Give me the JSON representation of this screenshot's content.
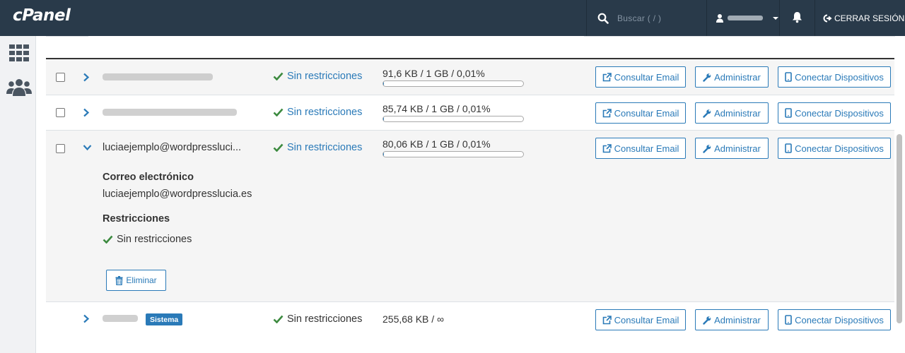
{
  "header": {
    "logo": "cPanel",
    "search_placeholder": "Buscar ( / )",
    "logout_label": "CERRAR SESIÓN"
  },
  "accounts": [
    {
      "account": "",
      "restrictions": "Sin restricciones",
      "usage": "91,6 KB / 1 GB / 0,01%",
      "usage_fraction": 0.0001,
      "buttons": {
        "email": "Consultar Email",
        "admin": "Administrar",
        "devices": "Conectar Dispositivos"
      }
    },
    {
      "account": "",
      "restrictions": "Sin restricciones",
      "usage": "85,74 KB / 1 GB / 0,01%",
      "usage_fraction": 0.0001,
      "buttons": {
        "email": "Consultar Email",
        "admin": "Administrar",
        "devices": "Conectar Dispositivos"
      }
    },
    {
      "account": "luciaejemplo@wordpressluci...",
      "restrictions": "Sin restricciones",
      "usage": "80,06 KB / 1 GB / 0,01%",
      "usage_fraction": 0.0001,
      "buttons": {
        "email": "Consultar Email",
        "admin": "Administrar",
        "devices": "Conectar Dispositivos"
      },
      "details": {
        "email_label": "Correo electrónico",
        "email_value": "luciaejemplo@wordpresslucia.es",
        "restrictions_label": "Restricciones",
        "restrictions_value": "Sin restricciones",
        "delete_label": "Eliminar"
      }
    },
    {
      "account": "",
      "badge": "Sistema",
      "restrictions": "Sin restricciones",
      "usage": "255,68 KB / ∞",
      "buttons": {
        "email": "Consultar Email",
        "admin": "Administrar",
        "devices": "Conectar Dispositivos"
      }
    }
  ],
  "colors": {
    "topbar": "#293a4a",
    "accent": "#2a7ab8",
    "check": "#3c8a3f"
  }
}
